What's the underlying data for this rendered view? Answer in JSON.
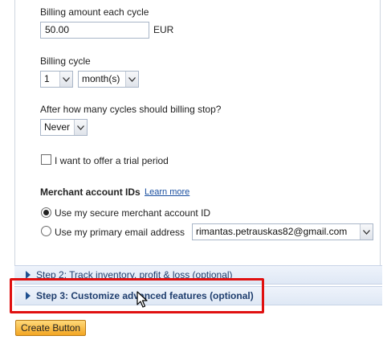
{
  "billing_amount": {
    "label": "Billing amount each cycle",
    "value": "50.00",
    "currency": "EUR"
  },
  "billing_cycle": {
    "label": "Billing cycle",
    "count": "1",
    "unit": "month(s)"
  },
  "billing_stop": {
    "label": "After how many cycles should billing stop?",
    "value": "Never"
  },
  "trial": {
    "label": "I want to offer a trial period",
    "checked": false
  },
  "merchant": {
    "heading": "Merchant account IDs",
    "learn_more": "Learn more",
    "option_secure": "Use my secure merchant account ID",
    "option_email": "Use my primary email address",
    "email_value": "rimantas.petrauskas82@gmail.com",
    "selected": "secure"
  },
  "steps": {
    "step2": "Step 2: Track inventory, profit & loss (optional)",
    "step3": "Step 3: Customize advanced features (optional)"
  },
  "create_button": "Create Button",
  "colors": {
    "highlight": "#e01010",
    "button_top": "#ffd97a",
    "button_bottom": "#f3a623",
    "step_text": "#1f3e6e",
    "link": "#1a4fa0"
  }
}
